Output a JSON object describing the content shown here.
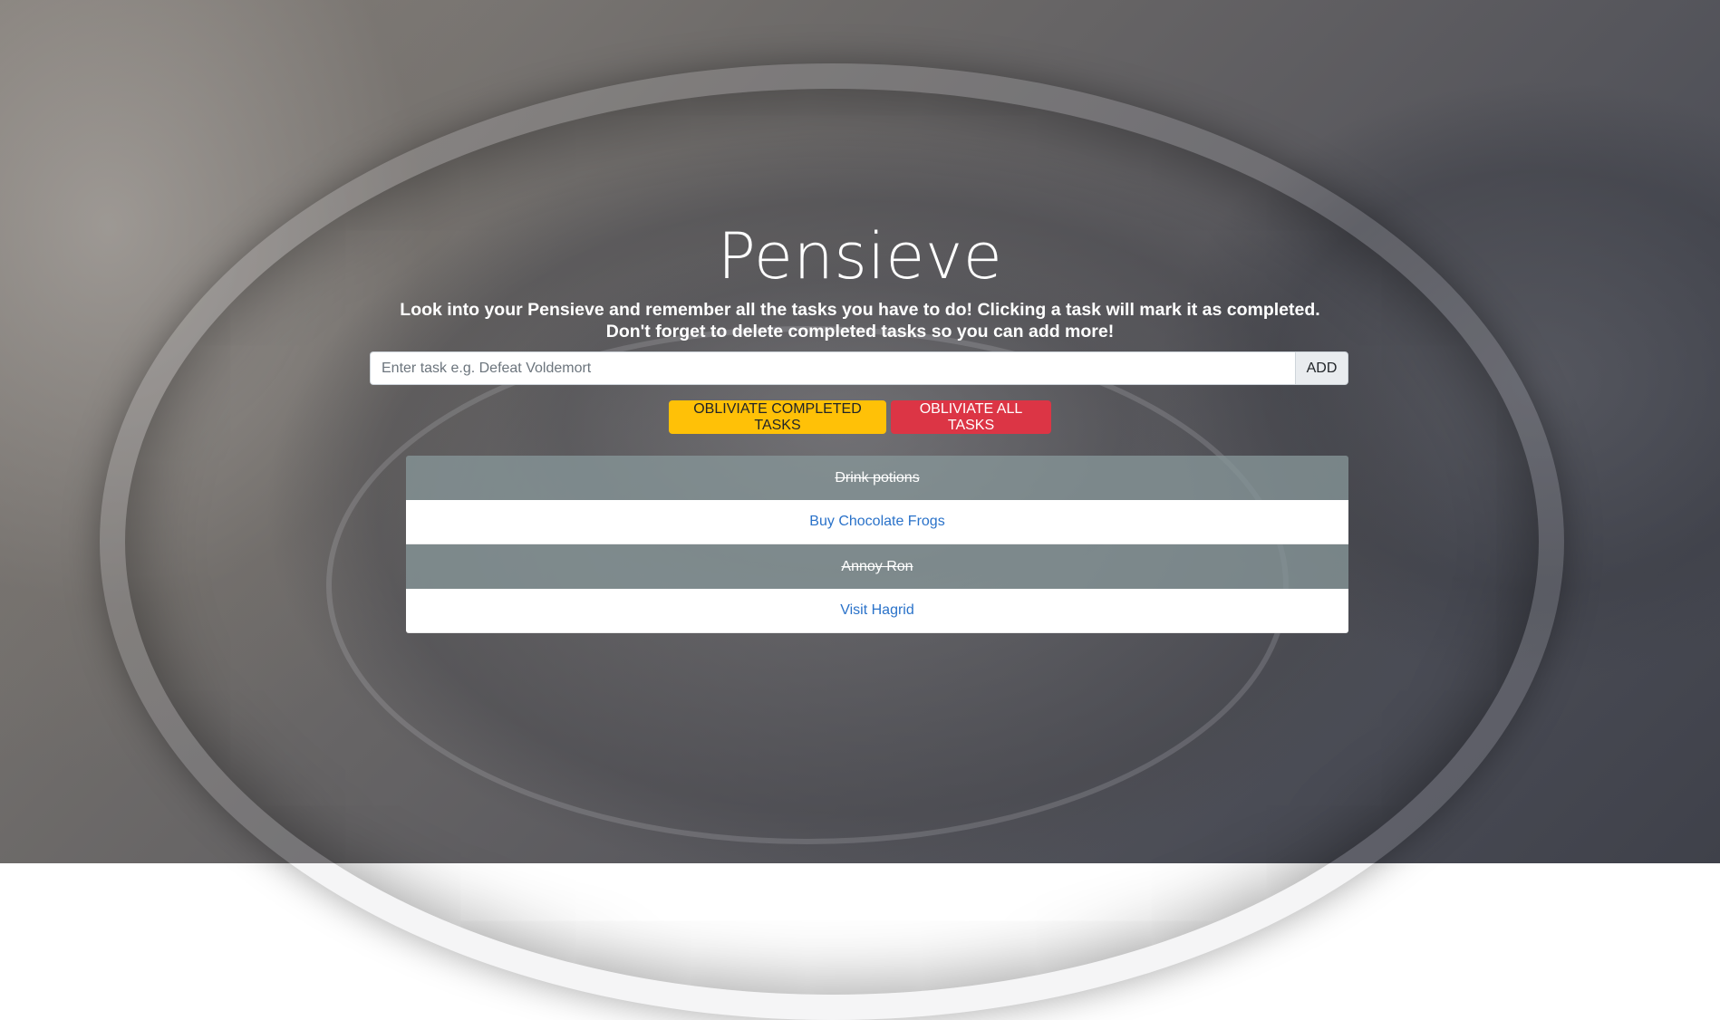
{
  "app": {
    "title": "Pensieve",
    "subtitle": "Look into your Pensieve and remember all the tasks you have to do! Clicking a task will mark it as completed. Don't forget to delete completed tasks so you can add more!"
  },
  "task_input": {
    "placeholder": "Enter task e.g. Defeat Voldemort",
    "value": "",
    "add_label": "ADD"
  },
  "actions": {
    "obliviate_completed_label": "OBLIVIATE COMPLETED TASKS",
    "obliviate_all_label": "OBLIVIATE ALL TASKS"
  },
  "tasks": [
    {
      "label": "Drink potions",
      "completed": true
    },
    {
      "label": "Buy Chocolate Frogs",
      "completed": false
    },
    {
      "label": "Annoy Ron",
      "completed": true
    },
    {
      "label": "Visit Hagrid",
      "completed": false
    }
  ],
  "colors": {
    "warning": "#ffc107",
    "danger": "#dc3545",
    "pending_task_text": "#2a72c9",
    "completed_task_bg": "#879698"
  }
}
